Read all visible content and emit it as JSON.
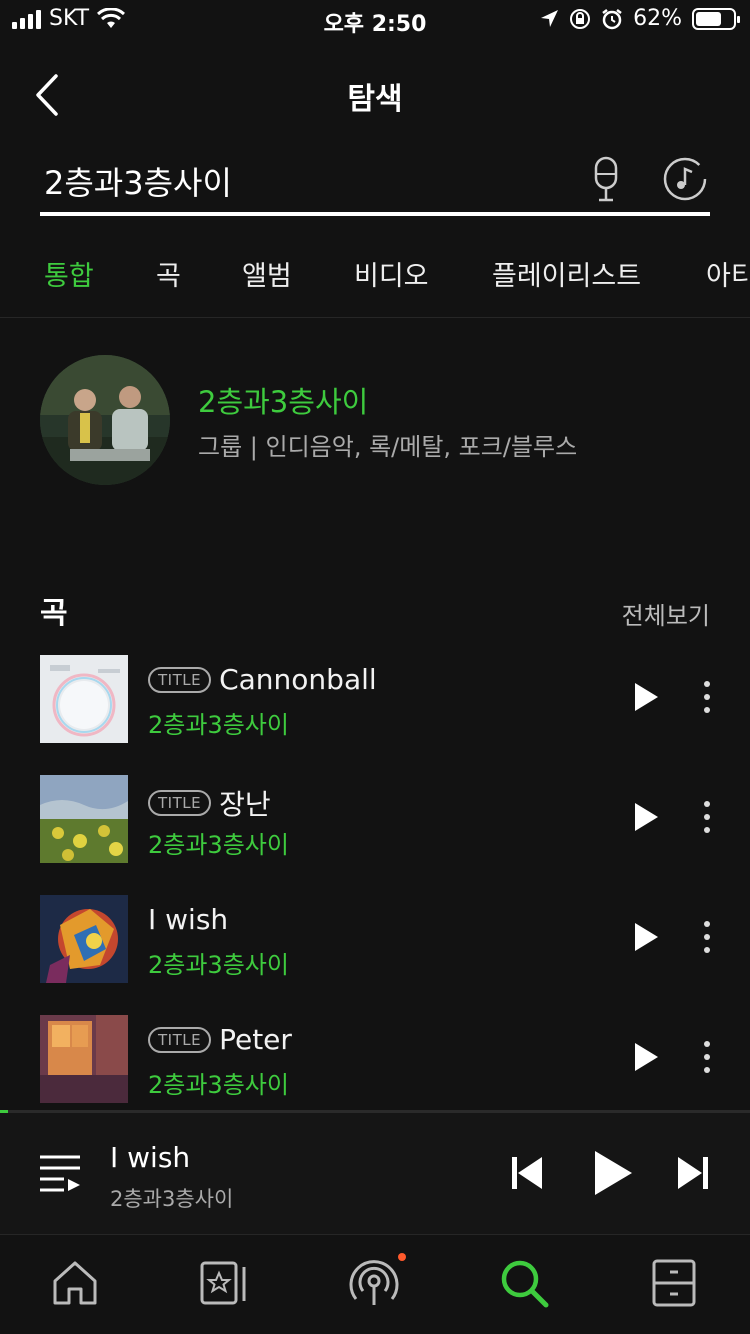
{
  "status_bar": {
    "carrier": "SKT",
    "time": "오후 2:50",
    "battery": "62%"
  },
  "header": {
    "title": "탐색"
  },
  "search": {
    "query": "2층과3층사이"
  },
  "tabs": [
    "통합",
    "곡",
    "앨범",
    "비디오",
    "플레이리스트",
    "아티"
  ],
  "active_tab": "통합",
  "artist": {
    "name": "2층과3층사이",
    "meta": "그룹 | 인디음악, 록/메탈, 포크/블루스"
  },
  "songs_section": {
    "title": "곡",
    "see_all": "전체보기"
  },
  "songs": [
    {
      "badge": "TITLE",
      "title": "Cannonball",
      "artist": "2층과3층사이"
    },
    {
      "badge": "TITLE",
      "title": "장난",
      "artist": "2층과3층사이"
    },
    {
      "badge": "",
      "title": "I wish",
      "artist": "2층과3층사이"
    },
    {
      "badge": "TITLE",
      "title": "Peter",
      "artist": "2층과3층사이"
    }
  ],
  "now_playing": {
    "title": "I wish",
    "artist": "2층과3층사이",
    "progress": 0.01
  },
  "colors": {
    "accent": "#3ecb3e",
    "background": "#121212",
    "notification": "#ff5a2c"
  },
  "nav": [
    "home-icon",
    "library-icon",
    "podcast-icon",
    "search-icon",
    "storage-icon"
  ]
}
